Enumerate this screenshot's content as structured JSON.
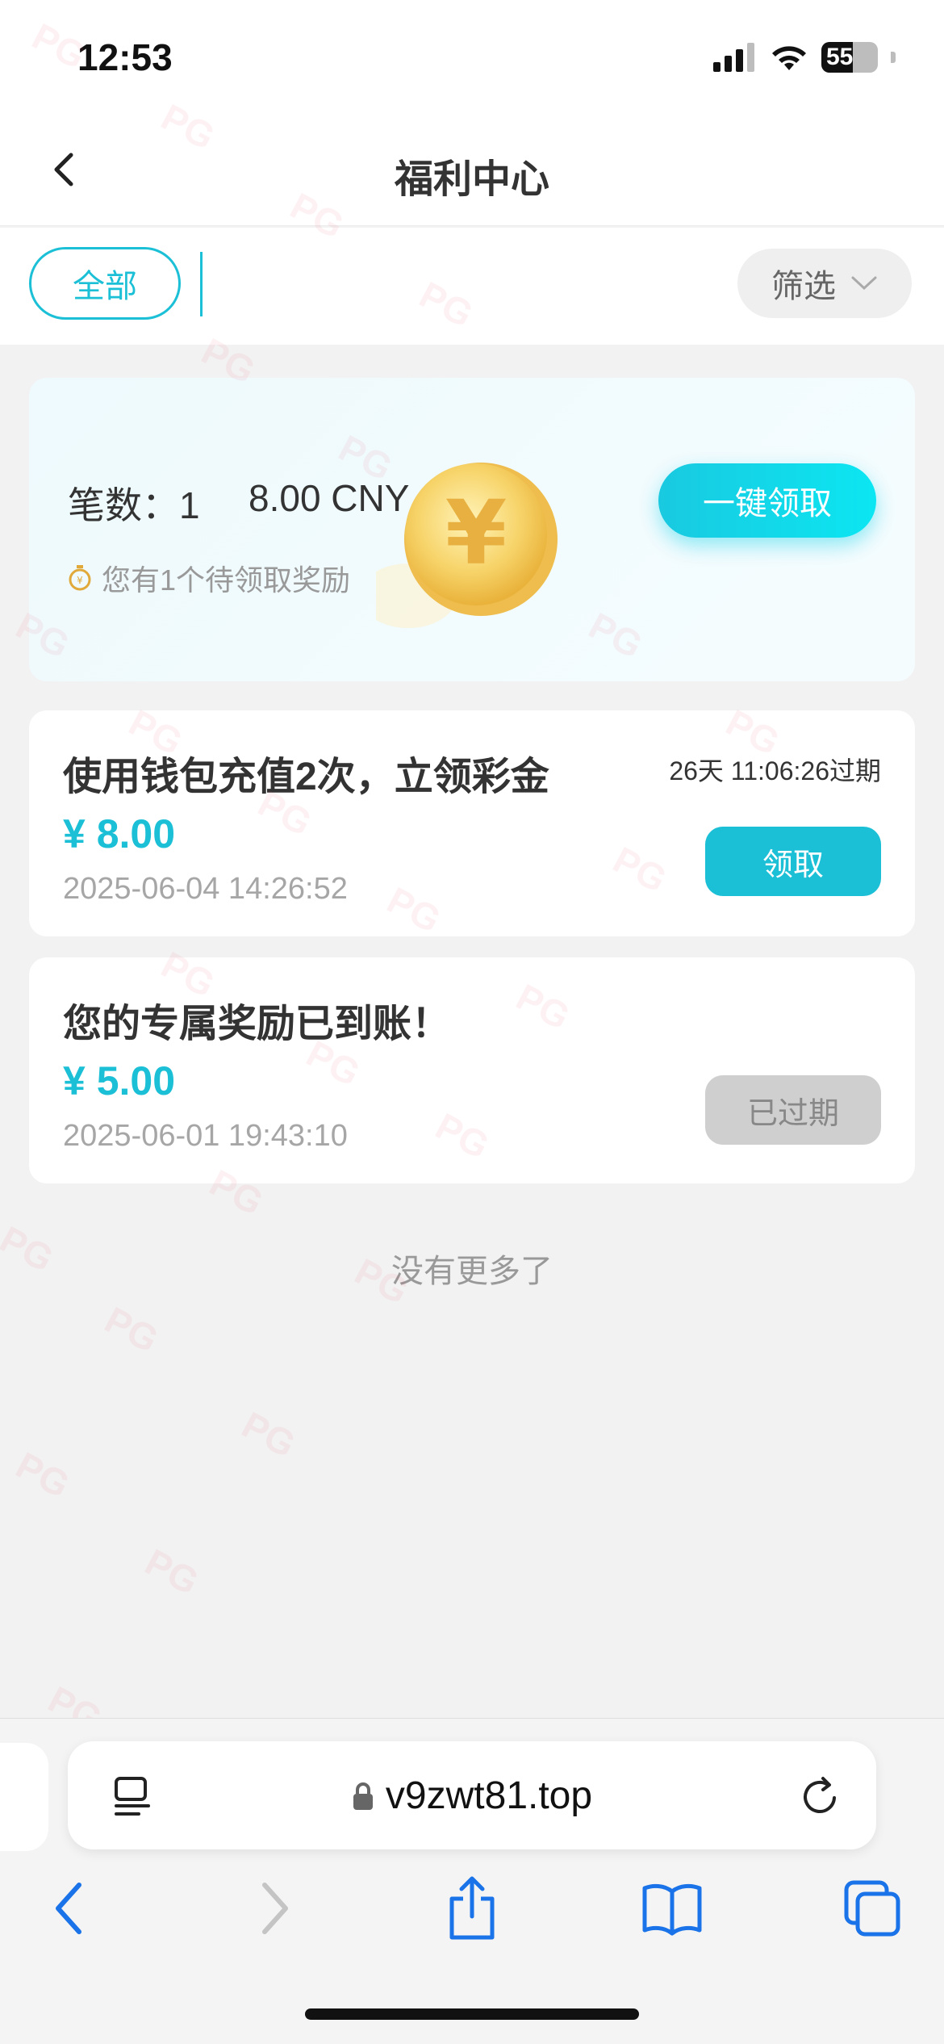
{
  "status_bar": {
    "time": "12:53",
    "battery": "55"
  },
  "nav": {
    "title": "福利中心"
  },
  "filter": {
    "tab_all": "全部",
    "filter_label": "筛选"
  },
  "summary": {
    "count_label": "笔数：1",
    "amount": "8.00 CNY",
    "pending_text": "您有1个待领取奖励",
    "claim_all_label": "一键领取"
  },
  "rewards": [
    {
      "title": "使用钱包充值2次，立领彩金",
      "amount": "¥ 8.00",
      "date": "2025-06-04 14:26:52",
      "expire": "26天 11:06:26过期",
      "button": "领取"
    },
    {
      "title": "您的专属奖励已到账！",
      "amount": "¥ 5.00",
      "date": "2025-06-01 19:43:10",
      "button": "已过期"
    }
  ],
  "no_more": "没有更多了",
  "browser": {
    "url": "v9zwt81.top"
  },
  "watermark": "PG",
  "colors": {
    "accent": "#1bbfd6",
    "expired_button": "#cfcfcf",
    "background": "#f2f2f2"
  }
}
